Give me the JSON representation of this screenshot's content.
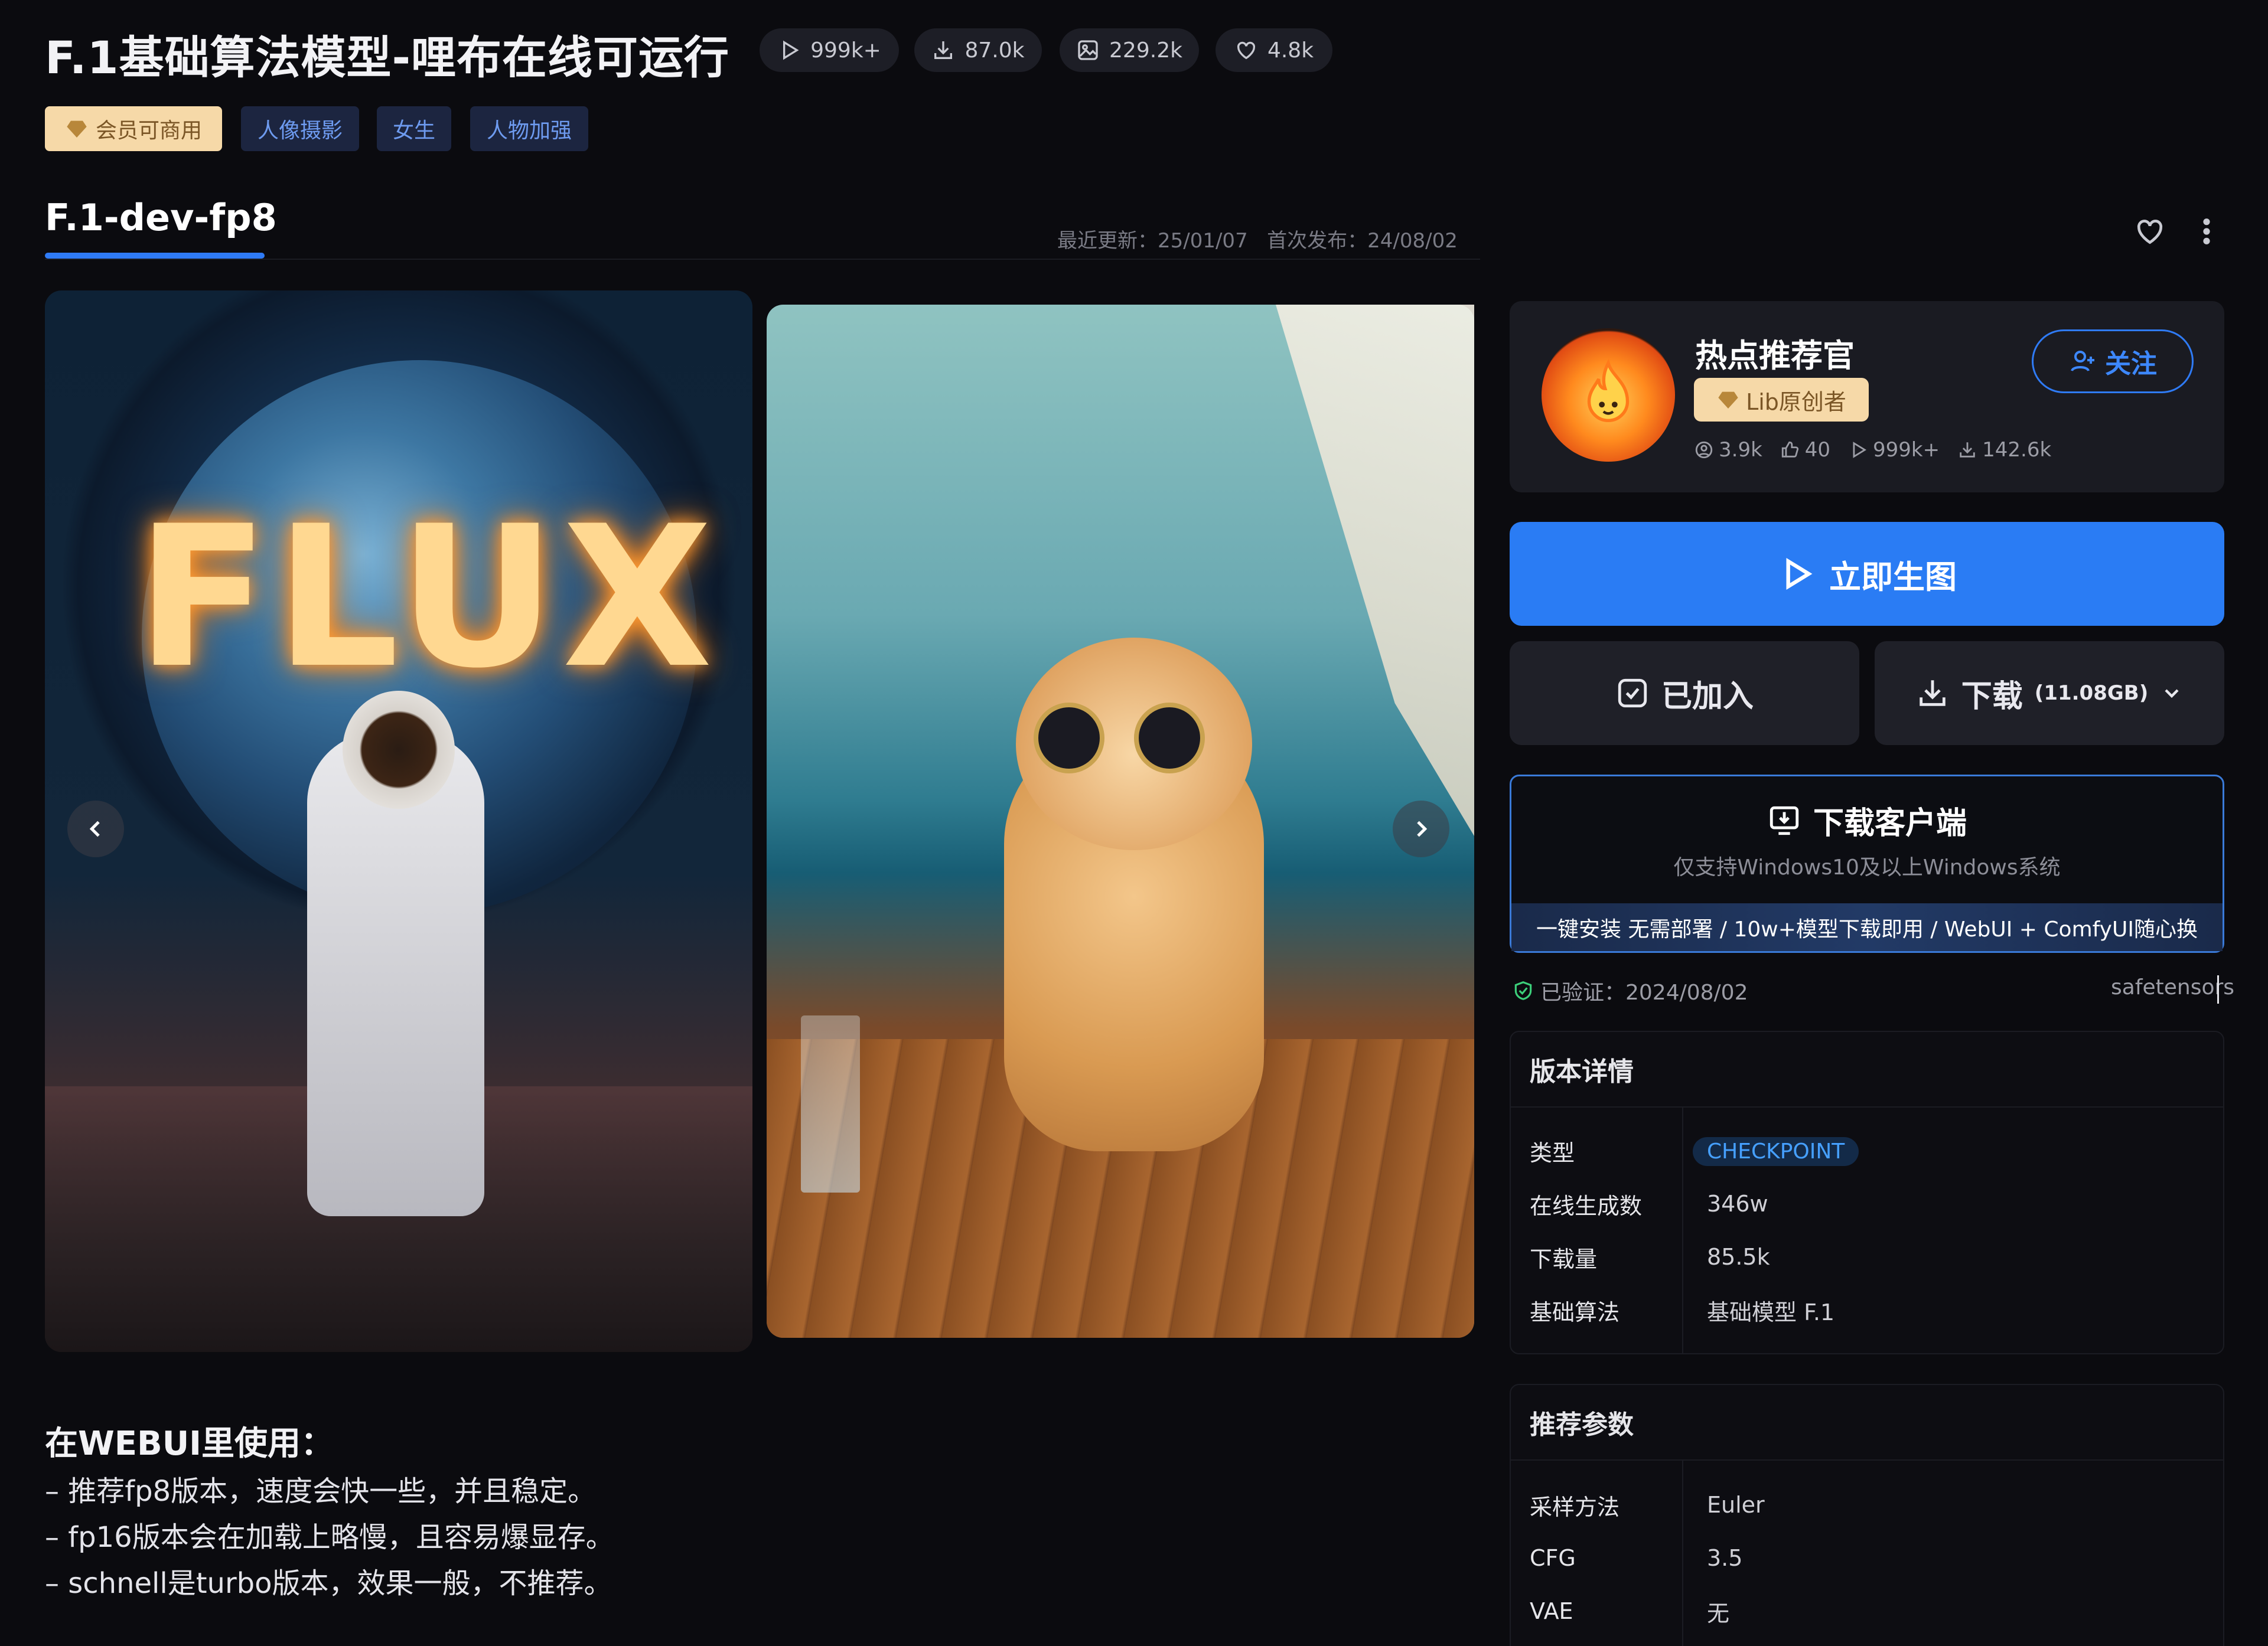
{
  "header": {
    "title": "F.1基础算法模型-哩布在线可运行",
    "stats": [
      {
        "icon": "play-icon",
        "value": "999k+"
      },
      {
        "icon": "download-icon",
        "value": "87.0k"
      },
      {
        "icon": "image-icon",
        "value": "229.2k"
      },
      {
        "icon": "heart-icon",
        "value": "4.8k"
      }
    ],
    "tags": [
      {
        "label": "会员可商用",
        "type": "vip"
      },
      {
        "label": "人像摄影",
        "type": "normal"
      },
      {
        "label": "女生",
        "type": "normal"
      },
      {
        "label": "人物加强",
        "type": "normal"
      }
    ]
  },
  "version_tab": {
    "name": "F.1-dev-fp8",
    "updated": "最近更新：25/01/07",
    "published": "首次发布：24/08/02"
  },
  "gallery": {
    "image1_overlay_text": "FLUX"
  },
  "description": {
    "title": "在WEBUI里使用：",
    "lines": [
      "– 推荐fp8版本，速度会快一些，并且稳定。",
      "– fp16版本会在加载上略慢，且容易爆显存。",
      "– schnell是turbo版本，效果一般，不推荐。"
    ]
  },
  "author": {
    "name": "热点推荐官",
    "badge": "Lib原创者",
    "follow_label": "关注",
    "stats": [
      {
        "icon": "user-icon",
        "value": "3.9k"
      },
      {
        "icon": "like-icon",
        "value": "40"
      },
      {
        "icon": "play-icon",
        "value": "999k+"
      },
      {
        "icon": "download-icon",
        "value": "142.6k"
      }
    ]
  },
  "actions": {
    "generate": "立即生图",
    "added": "已加入",
    "download": "下载",
    "download_size": "(11.08GB)"
  },
  "client": {
    "title": "下载客户端",
    "subtitle": "仅支持Windows10及以上Windows系统",
    "promo": "一键安装 无需部署 / 10w+模型下载即用 / WebUI + ComfyUI随心换"
  },
  "verification": {
    "text": "已验证：2024/08/02",
    "format": "safetensors"
  },
  "version_details": {
    "title": "版本详情",
    "rows": [
      {
        "key": "类型",
        "value": "CHECKPOINT"
      },
      {
        "key": "在线生成数",
        "value": "346w"
      },
      {
        "key": "下载量",
        "value": "85.5k"
      },
      {
        "key": "基础算法",
        "value": "基础模型 F.1"
      }
    ]
  },
  "recommended_params": {
    "title": "推荐参数",
    "rows": [
      {
        "key": "采样方法",
        "value": "Euler"
      },
      {
        "key": "CFG",
        "value": "3.5"
      },
      {
        "key": "VAE",
        "value": "无"
      }
    ]
  },
  "colors": {
    "accent": "#2a7cf4",
    "background": "#0b0b0f",
    "vip_tag": "#f6d9a8",
    "checkpoint_badge": "#46a0ff"
  }
}
